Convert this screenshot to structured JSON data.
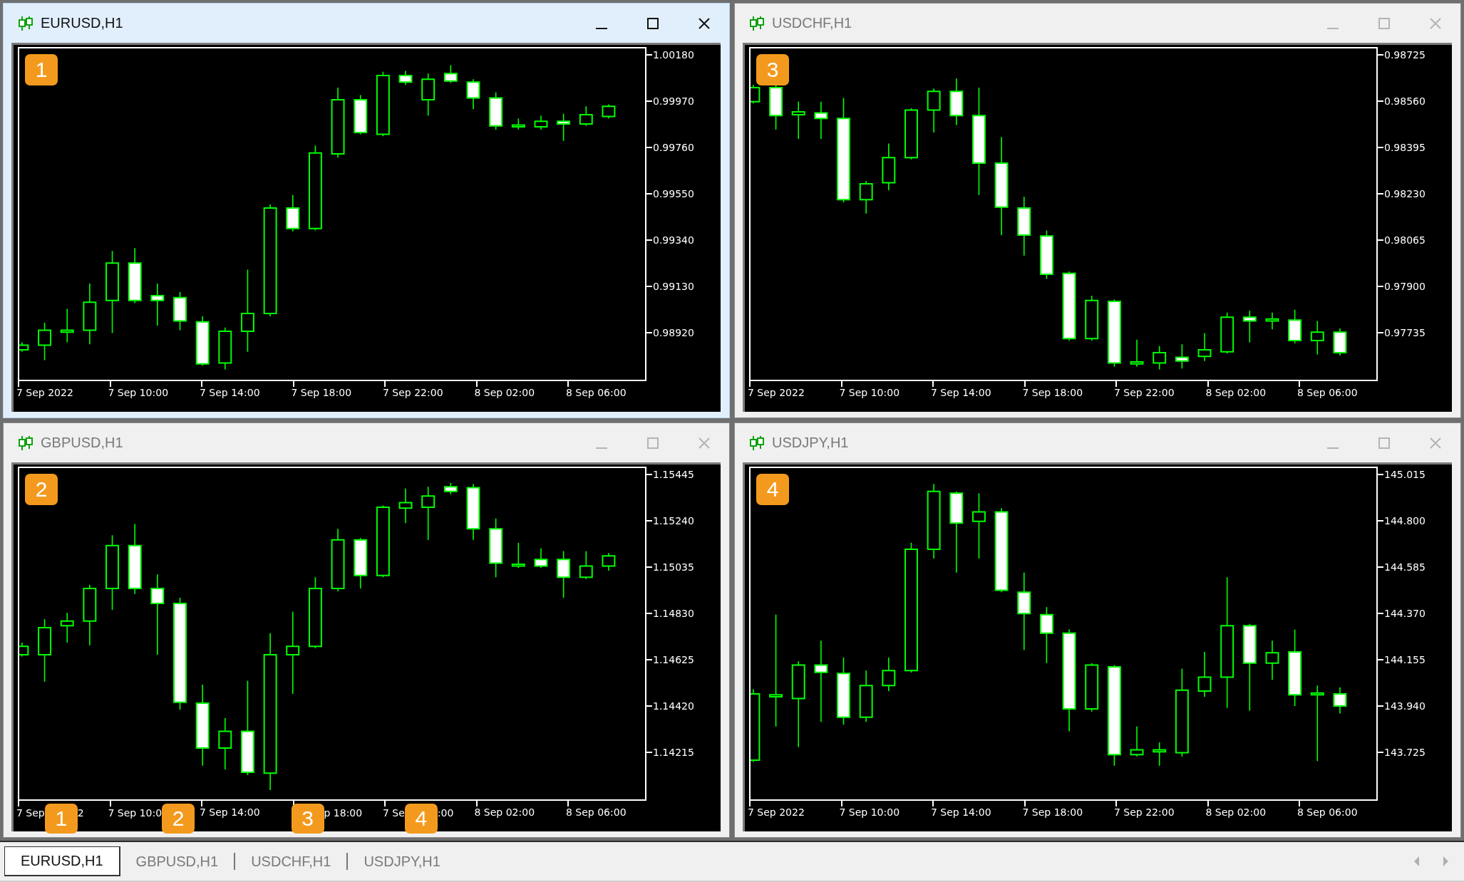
{
  "windows": [
    {
      "title": "EURUSD,H1",
      "active": true,
      "badge": "1",
      "price_labels": [
        "1.00180",
        "0.99970",
        "0.99760",
        "0.99550",
        "0.99340",
        "0.99130",
        "0.98920"
      ],
      "time_labels": [
        {
          "text": "7 Sep 2022"
        },
        {
          "text": "7 Sep 10:00"
        },
        {
          "text": "7 Sep 14:00"
        },
        {
          "text": "7 Sep 18:00"
        },
        {
          "text": "7 Sep 22:00"
        },
        {
          "text": "8 Sep 02:00"
        },
        {
          "text": "8 Sep 06:00"
        }
      ]
    },
    {
      "title": "USDCHF,H1",
      "active": false,
      "badge": "3",
      "price_labels": [
        "0.98725",
        "0.98560",
        "0.98395",
        "0.98230",
        "0.98065",
        "0.97900",
        "0.97735"
      ],
      "time_labels": [
        {
          "text": "7 Sep 2022"
        },
        {
          "text": "7 Sep 10:00"
        },
        {
          "text": "7 Sep 14:00"
        },
        {
          "text": "7 Sep 18:00"
        },
        {
          "text": "7 Sep 22:00"
        },
        {
          "text": "8 Sep 02:00"
        },
        {
          "text": "8 Sep 06:00"
        }
      ]
    },
    {
      "title": "GBPUSD,H1",
      "active": false,
      "badge": "2",
      "price_labels": [
        "1.15445",
        "1.15240",
        "1.15035",
        "1.14830",
        "1.14625",
        "1.14420",
        "1.14215"
      ],
      "time_labels": [
        {
          "text": "7 Sep",
          "callout": "1",
          "after": "2"
        },
        {
          "text": "7 Sep 10:0",
          "callout": "2"
        },
        {
          "text": "7 Sep 14:00"
        },
        {
          "callout": "3",
          "after": "p 18:00"
        },
        {
          "text": "7 Se",
          "callout": "4",
          "after": ":00"
        },
        {
          "text": "8 Sep 02:00"
        },
        {
          "text": "8 Sep 06:00"
        }
      ]
    },
    {
      "title": "USDJPY,H1",
      "active": false,
      "badge": "4",
      "price_labels": [
        "145.015",
        "144.800",
        "144.585",
        "144.370",
        "144.155",
        "143.940",
        "143.725"
      ],
      "time_labels": [
        {
          "text": "7 Sep 2022"
        },
        {
          "text": "7 Sep 10:00"
        },
        {
          "text": "7 Sep 14:00"
        },
        {
          "text": "7 Sep 18:00"
        },
        {
          "text": "7 Sep 22:00"
        },
        {
          "text": "8 Sep 02:00"
        },
        {
          "text": "8 Sep 06:00"
        }
      ]
    }
  ],
  "tabs": [
    {
      "label": "EURUSD,H1",
      "selected": true
    },
    {
      "label": "GBPUSD,H1",
      "selected": false
    },
    {
      "label": "USDCHF,H1",
      "selected": false
    },
    {
      "label": "USDJPY,H1",
      "selected": false
    }
  ]
}
